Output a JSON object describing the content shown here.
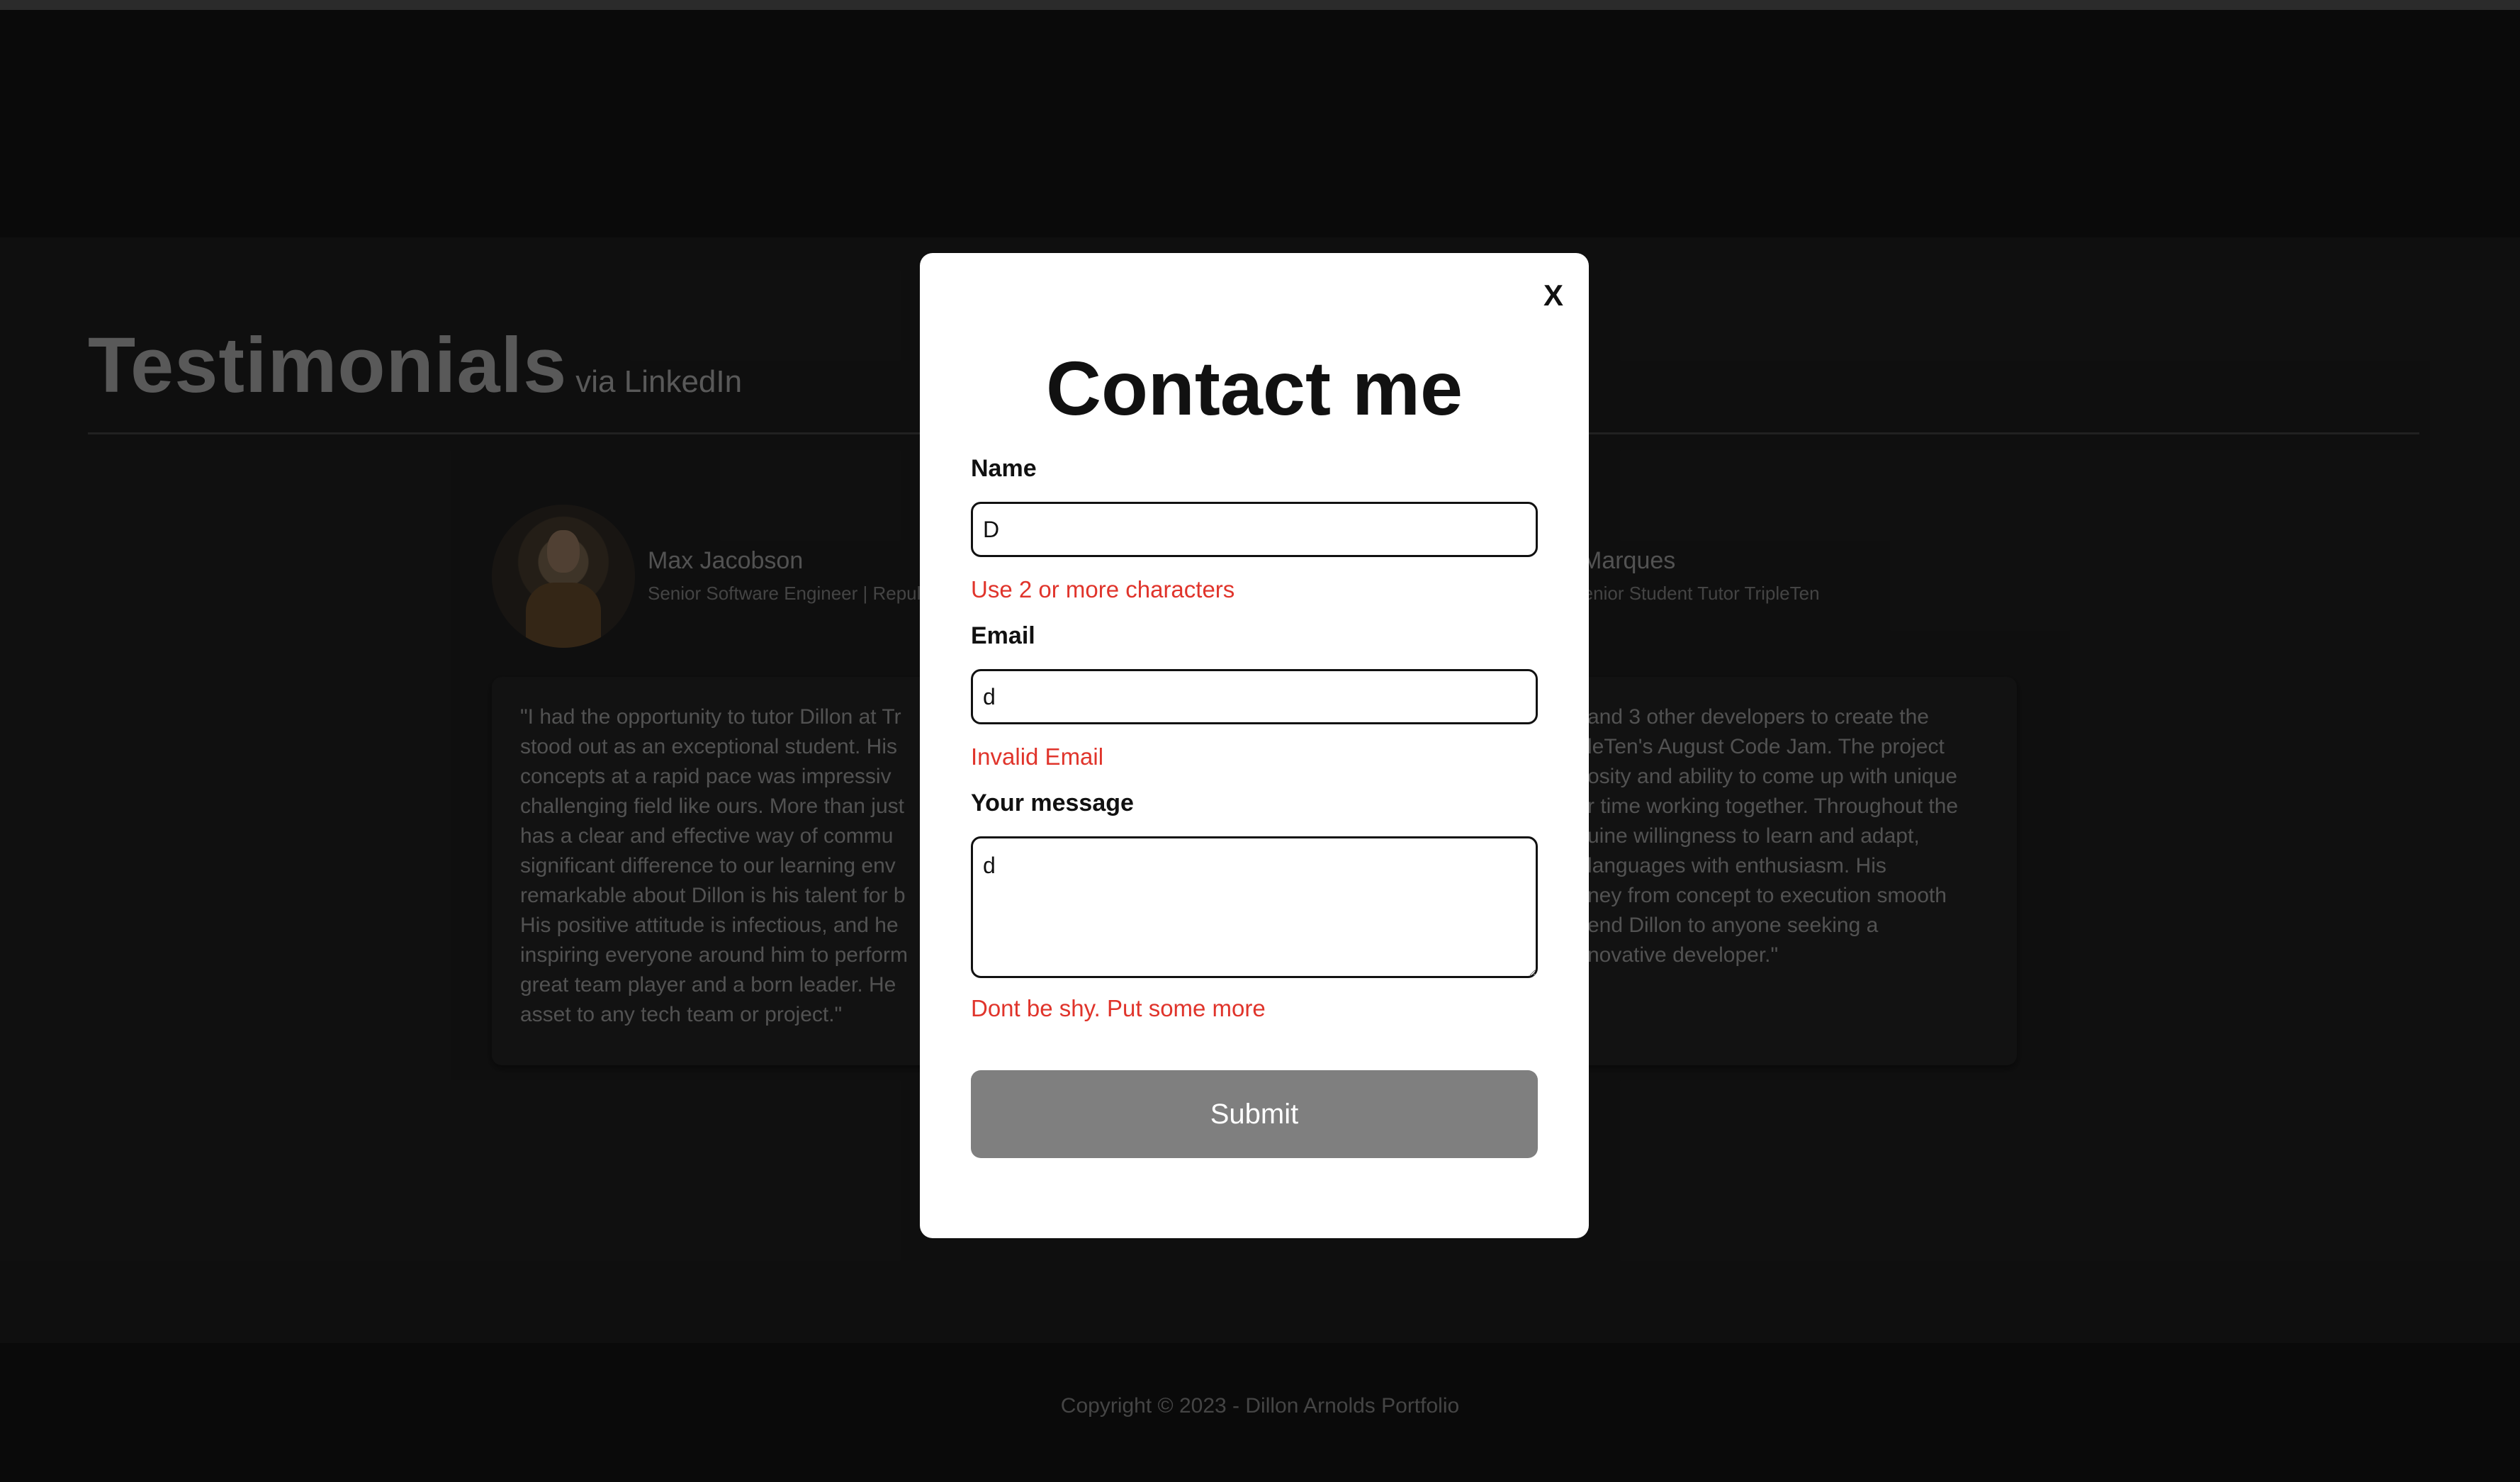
{
  "testimonials": {
    "title": "Testimonials",
    "subtitle": "via LinkedIn",
    "items": [
      {
        "name": "Max Jacobson",
        "role": "Senior Software Engineer | Repul",
        "quote": "\"I had the opportunity to tutor Dillon at Tr\nstood out as an exceptional student. His\nconcepts at a rapid pace was impressiv\nchallenging field like ours. More than just\nhas a clear and effective way of commu\nsignificant difference to our learning env\nremarkable about Dillon is his talent for b\nHis positive attitude is infectious, and he\ninspiring everyone around him to perform\ngreat team player and a born leader. He\nasset to any tech team or project.\""
      },
      {
        "name": "Marques",
        "role": "er | Senior Student Tutor TripleTen",
        "quote": "and 3 other developers to create the\nleTen's August Code Jam. The project\nosity and ability to come up with unique\nr time working together. Throughout the\nuine willingness to learn and adapt,\nlanguages with enthusiasm. His\nney from concept to execution smooth\nend Dillon to anyone seeking a\nnovative developer.\""
      }
    ]
  },
  "footer": {
    "copyright": "Copyright © 2023 - Dillon Arnolds Portfolio"
  },
  "modal": {
    "close_label": "X",
    "title": "Contact me",
    "name_label": "Name",
    "name_value": "D",
    "name_error": "Use 2 or more characters",
    "email_label": "Email",
    "email_value": "d",
    "email_error": "Invalid Email",
    "message_label": "Your message",
    "message_value": "d",
    "message_error": "Dont be shy. Put some more",
    "submit_label": "Submit"
  }
}
